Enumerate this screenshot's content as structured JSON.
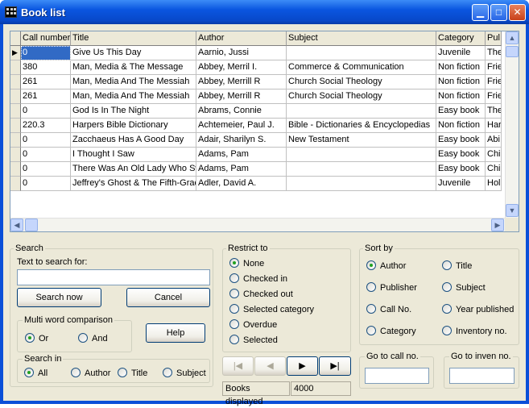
{
  "window": {
    "title": "Book list",
    "minimize_glyph": "▁",
    "maximize_glyph": "□",
    "close_glyph": "✕"
  },
  "grid": {
    "current_row_marker": "▶",
    "columns": [
      "Call number",
      "Title",
      "Author",
      "Subject",
      "Category",
      "Pul"
    ],
    "rows": [
      [
        "0",
        "Give Us This Day",
        "Aarnio, Jussi",
        "",
        "Juvenile",
        "The"
      ],
      [
        "380",
        "Man, Media & The Message",
        "Abbey, Merril I.",
        "Commerce & Communication",
        "Non fiction",
        "Frie"
      ],
      [
        "261",
        "Man, Media And The Messiah",
        "Abbey, Merrill R",
        "Church Social Theology",
        "Non fiction",
        "Frie"
      ],
      [
        "261",
        "Man, Media And The Messiah",
        "Abbey, Merrill R",
        "Church Social Theology",
        "Non fiction",
        "Frie"
      ],
      [
        "0",
        "God Is In The Night",
        "Abrams, Connie",
        "",
        "Easy book",
        "The"
      ],
      [
        "220.3",
        "Harpers Bible Dictionary",
        "Achtemeier, Paul J.",
        "Bible - Dictionaries & Encyclopedias",
        "Non fiction",
        "Har"
      ],
      [
        "0",
        "Zacchaeus Has A Good Day",
        "Adair, Sharilyn S.",
        "New Testament",
        "Easy book",
        "Abi"
      ],
      [
        "0",
        "I Thought I Saw",
        "Adams, Pam",
        "",
        "Easy book",
        "Chi"
      ],
      [
        "0",
        "There Was An Old Lady Who Swallowed",
        "Adams, Pam",
        "",
        "Easy book",
        "Chi"
      ],
      [
        "0",
        "Jeffrey's Ghost & The Fifth-Grade",
        "Adler, David A.",
        "",
        "Juvenile",
        "Hol"
      ]
    ],
    "scroll_up": "▲",
    "scroll_down": "▼",
    "scroll_left": "◀",
    "scroll_right": "▶"
  },
  "search": {
    "label": "Search",
    "text_label": "Text to search for:",
    "text_value": "",
    "search_now": "Search now",
    "cancel": "Cancel",
    "help": "Help",
    "multi_word": {
      "label": "Multi word comparison",
      "options": [
        "Or",
        "And"
      ],
      "selected": "Or"
    },
    "search_in": {
      "label": "Search in",
      "options": [
        "All",
        "Author",
        "Title",
        "Subject"
      ],
      "selected": "All"
    }
  },
  "restrict": {
    "label": "Restrict to",
    "options": [
      "None",
      "Checked in",
      "Checked out",
      "Selected category",
      "Overdue",
      "Selected"
    ],
    "selected": "None"
  },
  "nav": {
    "first": "|◀",
    "prev": "◀",
    "next": "▶",
    "last": "▶|"
  },
  "status": {
    "books_label": "Books displayed",
    "books_count": "4000"
  },
  "sort": {
    "label": "Sort by",
    "options": [
      "Author",
      "Title",
      "Publisher",
      "Subject",
      "Call No.",
      "Year published",
      "Category",
      "Inventory no."
    ],
    "selected": "Author"
  },
  "goto_call": {
    "label": "Go to call no.",
    "value": ""
  },
  "goto_inven": {
    "label": "Go to inven no.",
    "value": ""
  }
}
